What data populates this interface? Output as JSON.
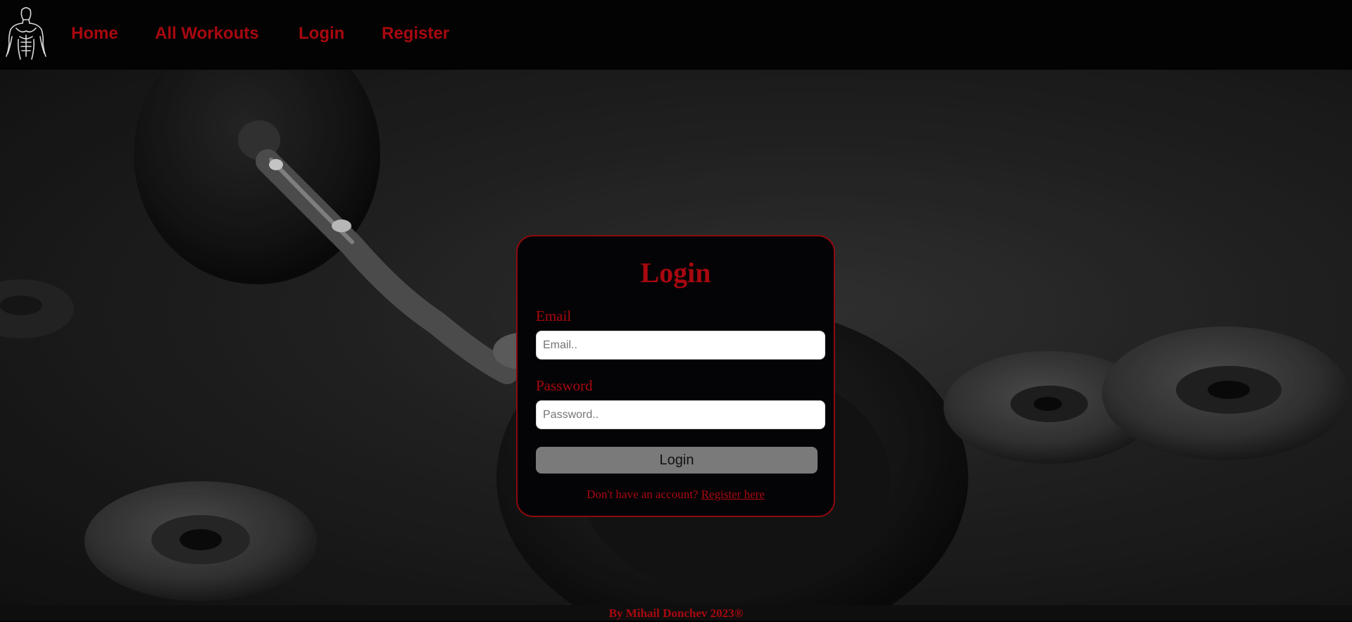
{
  "nav": {
    "logo": "bodybuilder-logo",
    "links": [
      "Home",
      "All Workouts",
      "Login",
      "Register"
    ]
  },
  "login": {
    "title": "Login",
    "email_label": "Email",
    "email_placeholder": "Email..",
    "email_value": "",
    "password_label": "Password",
    "password_placeholder": "Password..",
    "password_value": "",
    "submit_label": "Login",
    "register_prompt": "Don't have an account?",
    "register_link": "Register here"
  },
  "footer": {
    "text": "By Mihail Donchev 2023®"
  },
  "colors": {
    "accent": "#a8080f",
    "nav_background": "#030303",
    "card_background": "#040406",
    "button_background": "#7a7a7a"
  }
}
